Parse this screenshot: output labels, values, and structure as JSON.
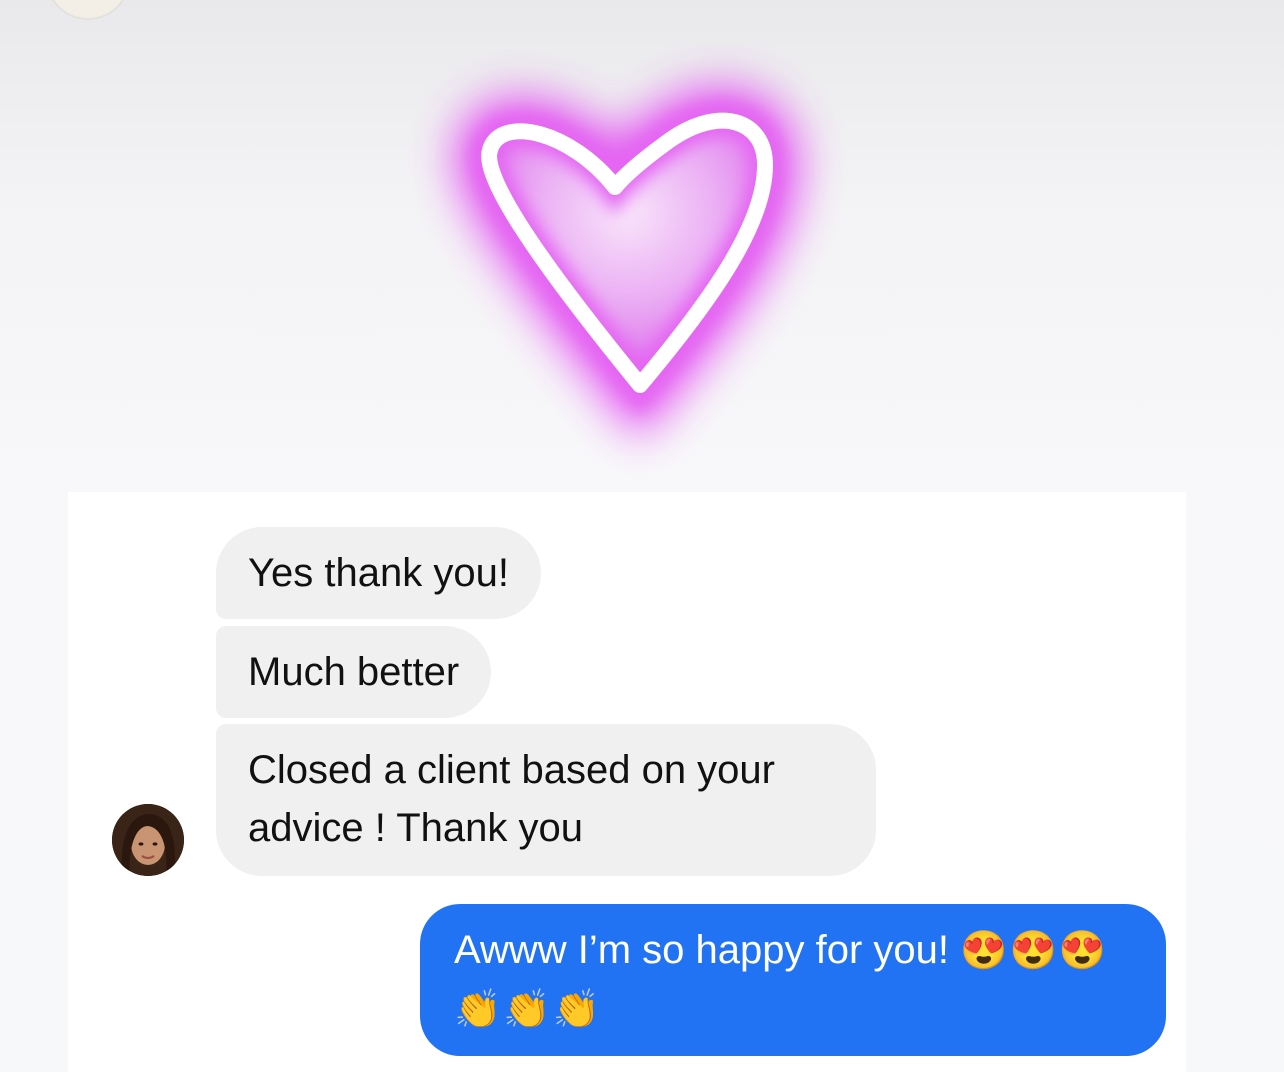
{
  "messages": [
    {
      "id": "m1",
      "direction": "incoming",
      "text": "Yes thank you!"
    },
    {
      "id": "m2",
      "direction": "incoming",
      "text": "Much better"
    },
    {
      "id": "m3",
      "direction": "incoming",
      "text": "Closed a client based on your advice ! Thank you"
    },
    {
      "id": "m4",
      "direction": "outgoing",
      "text": "Awww I’m so happy for you!",
      "emoji": "😍😍😍👏👏👏"
    }
  ],
  "colors": {
    "outgoing_bubble": "#2273f3",
    "incoming_bubble": "#f0f0f1",
    "neon_heart": "#e35bf0"
  },
  "icons": {
    "sticker": "neon-heart-icon",
    "sender_avatar": "avatar"
  }
}
